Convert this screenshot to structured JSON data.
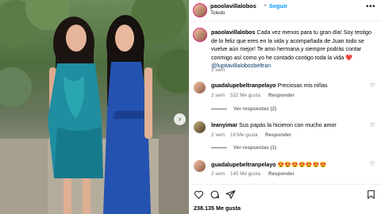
{
  "post": {
    "username": "paoolavillalobos",
    "follow_label": "Seguir",
    "location": "Toledo",
    "more_label": "•••",
    "dot": "•"
  },
  "caption": {
    "username": "paoolavillalobos",
    "text": "Cada vez menos para tu gran día! Soy testigo de lo feliz que eres en la vida y acompañada de Juan todo se vuelve aún mejor! Te amo hermana y siempre podrás contar conmigo así como yo he contado contigo toda la vida ❤️ ",
    "mention": "@lupitavillalobosbeltran",
    "time": "2 sem"
  },
  "comments": [
    {
      "username": "guadalupebeltranpelayo",
      "text": "Preciosas mis niñas",
      "time": "2 sem",
      "likes": "532 Me gusta",
      "reply_label": "Responder",
      "replies": "Ver respuestas (2)"
    },
    {
      "username": "leanyimar",
      "text": "Sus papás la hicieron con mucho amor",
      "time": "2 sem",
      "likes": "18 Me gusta",
      "reply_label": "Responder",
      "replies": "Ver respuestas (1)"
    },
    {
      "username": "guadalupebeltranpelayo",
      "text": "😍😍😍😍😍😍😍",
      "time": "2 sem",
      "likes": "145 Me gusta",
      "reply_label": "Responder"
    }
  ],
  "footer": {
    "likes_count": "238.135 Me gusta"
  },
  "icons": {
    "heart": "heart-icon",
    "comment": "comment-icon",
    "share": "share-icon",
    "save": "bookmark-icon",
    "next": "chevron-right-icon"
  },
  "colors": {
    "link": "#0095f6",
    "mention": "#00376b",
    "secondary": "#737373"
  }
}
